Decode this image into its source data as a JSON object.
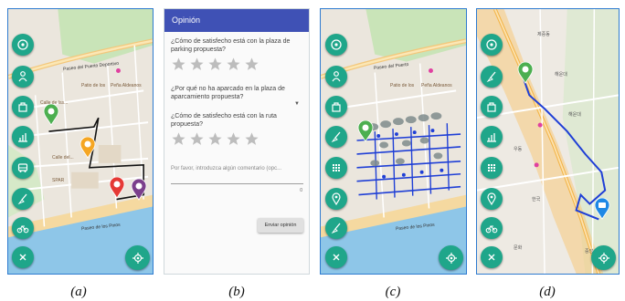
{
  "colors": {
    "fab": "#1fa68a",
    "header": "#3f51b5",
    "route_black": "#111111",
    "route_blue": "#1f3fd6"
  },
  "captions": [
    "(a)",
    "(b)",
    "(c)",
    "(d)"
  ],
  "panel_a": {
    "labels": {
      "street_top": "Paseo del Puerto Deportivo",
      "place1": "Patio de los",
      "place2": "Peña Aldeanos",
      "street_left": "Calle de las...",
      "street_mid": "Calle del...",
      "street_low": "Calle del...",
      "shop": "SPAR",
      "coast": "Paseo de los Pinos",
      "coast2": "Calle de la..."
    },
    "fab_icons": [
      "target-icon",
      "person-icon",
      "bag-icon",
      "chart-icon",
      "bus-icon",
      "broom-icon",
      "bike-icon",
      "close-icon"
    ],
    "locate_icon": "crosshair-icon"
  },
  "panel_b": {
    "title": "Opinión",
    "q1": "¿Cómo de satisfecho está con la plaza de parking propuesta?",
    "q2": "¿Por qué no ha aparcado en la plaza de aparcamiento propuesta?",
    "q3": "¿Cómo de satisfecho está con la ruta propuesta?",
    "comment_placeholder": "Por favor, introduzca algún comentario (opc...",
    "counter": "0",
    "send_label": "Enviar opinión",
    "dropdown_icon": "chevron-down-icon"
  },
  "panel_c": {
    "labels": {
      "place1": "Patio de los",
      "place2": "Peña Aldeanos",
      "street_top": "Paseo del Puerto",
      "coast": "Paseo de los Pinos"
    },
    "fab_icons": [
      "target-icon",
      "person-icon",
      "bag-icon",
      "broom-icon",
      "grid-icon",
      "pin-icon",
      "broom-icon",
      "close-icon"
    ],
    "locate_icon": "crosshair-icon"
  },
  "panel_d": {
    "labels": {
      "district": "제중동",
      "area1": "해운대",
      "area2": "우동",
      "area3": "해운대",
      "area4": "한국",
      "area5": "중앙",
      "area6": "문화"
    },
    "fab_icons": [
      "target-icon",
      "broom-icon",
      "bag-icon",
      "chart-icon",
      "grid-icon",
      "pin-icon",
      "bike-icon",
      "close-icon"
    ],
    "locate_icon": "crosshair-icon"
  }
}
